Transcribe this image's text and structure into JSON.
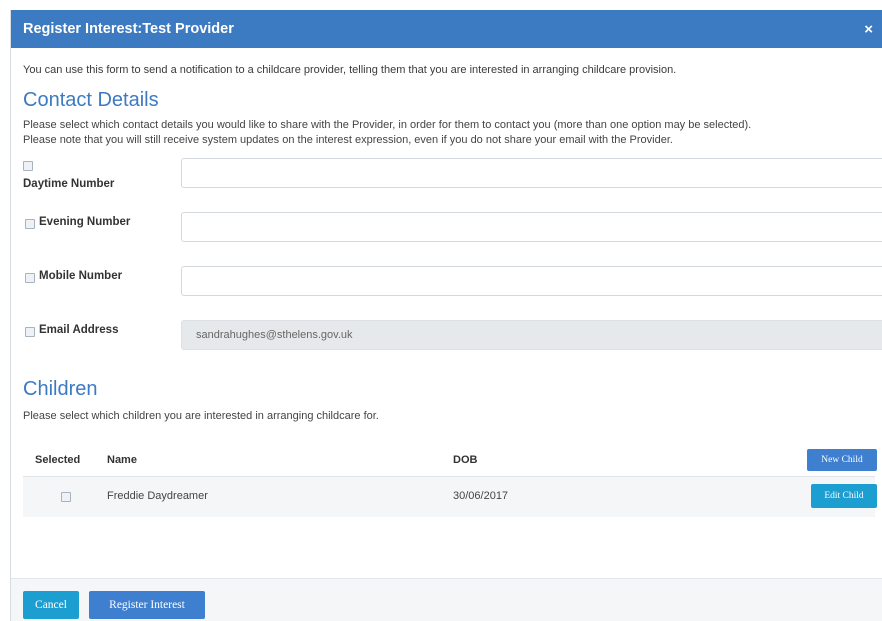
{
  "modal": {
    "title": "Register Interest:Test Provider",
    "close_label": "×"
  },
  "intro": "You can use this form to send a notification to a childcare provider, telling them that you are interested in arranging childcare provision.",
  "contact": {
    "title": "Contact Details",
    "desc_line1": "Please select which contact details you would like to share with the Provider, in order for them to contact you (more than one option may be selected).",
    "desc_line2": "Please note that you will still receive system updates on the interest expression, even if you do not share your email with the Provider.",
    "fields": [
      {
        "label": "Daytime Number",
        "value": ""
      },
      {
        "label": "Evening Number",
        "value": ""
      },
      {
        "label": "Mobile Number",
        "value": ""
      },
      {
        "label": "Email Address",
        "value": "sandrahughes@sthelens.gov.uk"
      }
    ]
  },
  "children": {
    "title": "Children",
    "desc": "Please select which children you are interested in arranging childcare for.",
    "columns": {
      "selected": "Selected",
      "name": "Name",
      "dob": "DOB"
    },
    "new_child_label": "New Child",
    "rows": [
      {
        "name": "Freddie Daydreamer",
        "dob": "30/06/2017",
        "edit_label": "Edit Child"
      }
    ]
  },
  "footer": {
    "cancel_label": "Cancel",
    "register_label": "Register Interest"
  },
  "colors": {
    "header": "#3c7ac2",
    "primary_button": "#3e7fd0",
    "info_button": "#1c9fd0"
  }
}
